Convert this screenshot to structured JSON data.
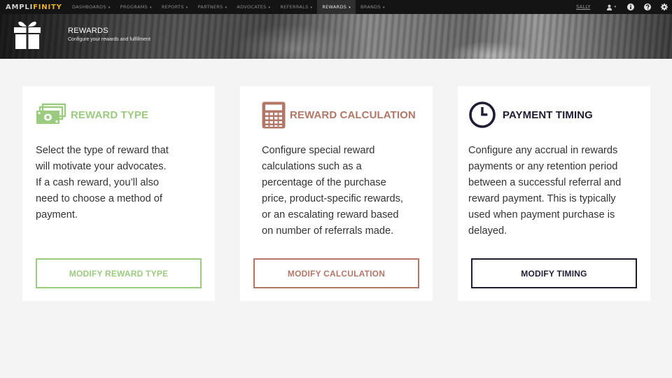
{
  "app": {
    "logo_part1": "AMPLI",
    "logo_part2": "FINITY"
  },
  "nav": {
    "items": [
      {
        "label": "DASHBOARDS",
        "active": false
      },
      {
        "label": "PROGRAMS",
        "active": false
      },
      {
        "label": "REPORTS",
        "active": false
      },
      {
        "label": "PARTNERS",
        "active": false
      },
      {
        "label": "ADVOCATES",
        "active": false
      },
      {
        "label": "REFERRALS",
        "active": false
      },
      {
        "label": "REWARDS",
        "active": true
      },
      {
        "label": "BRANDS",
        "active": false
      }
    ],
    "caret": "▾",
    "user_name": "SALLY"
  },
  "header": {
    "title": "REWARDS",
    "subtitle": "Configure your rewards and fulfillment",
    "icon": "gift-icon"
  },
  "cards": [
    {
      "title": "REWARD TYPE",
      "icon": "cash-icon",
      "color": "#9bcb7f",
      "description": "Select the type of reward that\nwill motivate your advocates.\nIf a cash reward, you’ll also\nneed to choose a method of\npayment.",
      "button_label": "MODIFY REWARD TYPE"
    },
    {
      "title": "REWARD CALCULATION",
      "icon": "calculator-icon",
      "color": "#b27766",
      "description": "Configure special reward\ncalculations such as a\npercentage of the purchase\nprice, product-specific rewards,\nor an escalating reward based\non number of referrals made.",
      "button_label": "MODIFY CALCULATION"
    },
    {
      "title": "PAYMENT TIMING",
      "icon": "clock-icon",
      "color": "#1e1d33",
      "description": "Configure any accrual in rewards\npayments or any retention period\nbetween a successful referral and\nreward payment. This is typically\nused when payment purchase is\ndelayed.",
      "button_label": "MODIFY TIMING"
    }
  ]
}
